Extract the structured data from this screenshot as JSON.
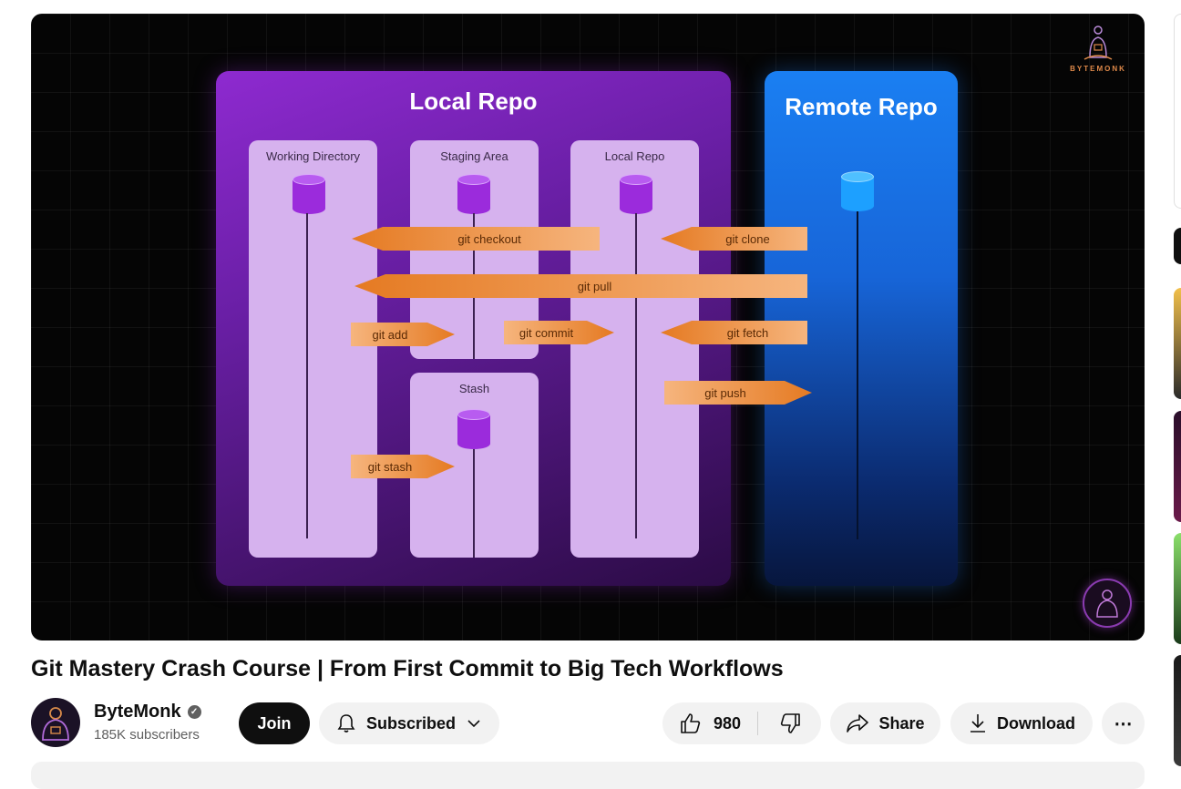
{
  "video": {
    "brand": "BYTEMONK",
    "diagram": {
      "local_panel_title": "Local Repo",
      "remote_panel_title": "Remote Repo",
      "columns": {
        "working": "Working Directory",
        "staging": "Staging Area",
        "local": "Local Repo",
        "stash": "Stash"
      },
      "arrows": {
        "checkout": "git checkout",
        "clone": "git clone",
        "pull": "git pull",
        "add": "git add",
        "commit": "git commit",
        "fetch": "git fetch",
        "push": "git push",
        "stash": "git stash"
      }
    }
  },
  "title": "Git Mastery Crash Course | From First Commit to Big Tech Workflows",
  "channel": {
    "name": "ByteMonk",
    "subscribers": "185K subscribers",
    "verified_icon": "check-icon"
  },
  "actions": {
    "join": "Join",
    "subscribed": "Subscribed",
    "likes": "980",
    "share": "Share",
    "download": "Download",
    "more": "⋯"
  },
  "colors": {
    "local_panel": "#8e2ad0",
    "remote_panel": "#1a7ff2",
    "arrow": "#e57a22",
    "join_bg": "#0f0f0f"
  }
}
